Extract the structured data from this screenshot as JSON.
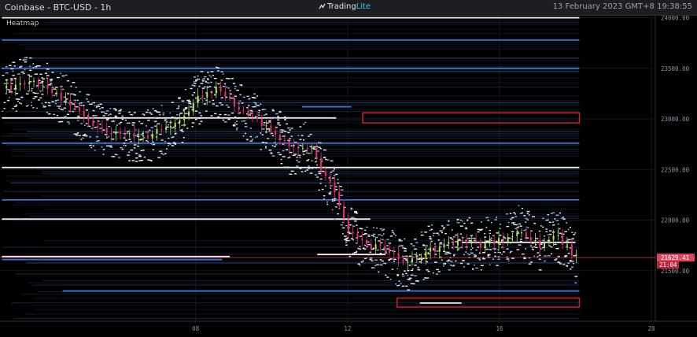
{
  "header": {
    "title": "Coinbase - BTC-USD - 1h",
    "brand_main": "Trading",
    "brand_accent": "Lite",
    "timestamp": "13 February 2023 GMT+8 19:38:55"
  },
  "chart_data": {
    "type": "heatmap",
    "panel_label": "Heatmap",
    "price_axis": {
      "ticks": [
        "24000.00",
        "23500.00",
        "23000.00",
        "22500.00",
        "22000.00",
        "21500.00"
      ],
      "range": [
        21000,
        24020
      ]
    },
    "time_axis": {
      "ticks": [
        "08",
        "12",
        "16",
        "20"
      ],
      "range_hours": [
        2.85,
        20.1
      ]
    },
    "last_price_label": "21629.41",
    "countdown_label": "21:04",
    "colors": {
      "candle_up": "#b9e45a",
      "candle_down": "#e8326e",
      "last_price": "#e0455f",
      "highlight_box": "#e01f1f",
      "liquidity_strong": "#f2f2f2",
      "liquidity_mid": "#3b74c9",
      "liquidity_weak": "#1c3566"
    },
    "price_path": [
      [
        3.0,
        23300
      ],
      [
        3.5,
        23380
      ],
      [
        4.0,
        23330
      ],
      [
        4.5,
        23200
      ],
      [
        5.0,
        23050
      ],
      [
        5.5,
        22900
      ],
      [
        6.0,
        22850
      ],
      [
        6.5,
        22800
      ],
      [
        7.0,
        22880
      ],
      [
        7.5,
        22950
      ],
      [
        8.0,
        23200
      ],
      [
        8.5,
        23300
      ],
      [
        9.0,
        23150
      ],
      [
        9.5,
        23000
      ],
      [
        10.0,
        22900
      ],
      [
        10.5,
        22700
      ],
      [
        11.0,
        22720
      ],
      [
        11.3,
        22500
      ],
      [
        11.6,
        22300
      ],
      [
        12.0,
        21900
      ],
      [
        12.5,
        21750
      ],
      [
        13.0,
        21700
      ],
      [
        13.5,
        21560
      ],
      [
        14.0,
        21680
      ],
      [
        14.5,
        21740
      ],
      [
        15.0,
        21780
      ],
      [
        15.5,
        21760
      ],
      [
        16.0,
        21800
      ],
      [
        16.5,
        21900
      ],
      [
        17.0,
        21750
      ],
      [
        17.5,
        21850
      ],
      [
        18.0,
        21629
      ]
    ],
    "liquidity_levels": [
      {
        "price": 23010,
        "from": 2.9,
        "to": 11.7,
        "strength": "strong"
      },
      {
        "price": 22520,
        "from": 2.9,
        "to": 18.1,
        "strength": "strong"
      },
      {
        "price": 22010,
        "from": 2.9,
        "to": 12.6,
        "strength": "strong"
      },
      {
        "price": 21640,
        "from": 2.9,
        "to": 8.9,
        "strength": "strong"
      },
      {
        "price": 21610,
        "from": 2.9,
        "to": 8.7,
        "strength": "mid"
      },
      {
        "price": 21660,
        "from": 11.2,
        "to": 13.0,
        "strength": "strong"
      },
      {
        "price": 21780,
        "from": 15.0,
        "to": 18.0,
        "strength": "strong"
      },
      {
        "price": 23120,
        "from": 10.8,
        "to": 12.1,
        "strength": "mid"
      },
      {
        "price": 23780,
        "from": 2.9,
        "to": 18.1,
        "strength": "mid"
      },
      {
        "price": 23500,
        "from": 2.9,
        "to": 18.1,
        "strength": "mid"
      },
      {
        "price": 22760,
        "from": 2.9,
        "to": 18.1,
        "strength": "mid"
      },
      {
        "price": 22200,
        "from": 2.9,
        "to": 18.1,
        "strength": "mid"
      },
      {
        "price": 21300,
        "from": 4.5,
        "to": 18.1,
        "strength": "mid"
      },
      {
        "price": 21180,
        "from": 13.9,
        "to": 15.0,
        "strength": "strong"
      },
      {
        "price": 24000,
        "from": 2.9,
        "to": 18.1,
        "strength": "strong"
      }
    ],
    "highlight_boxes": [
      {
        "price_high": 23060,
        "price_low": 22960,
        "from": 12.4,
        "to": 18.1
      },
      {
        "price_high": 21230,
        "price_low": 21140,
        "from": 13.3,
        "to": 18.1
      }
    ],
    "heatmap_end_hour": 18.1
  }
}
